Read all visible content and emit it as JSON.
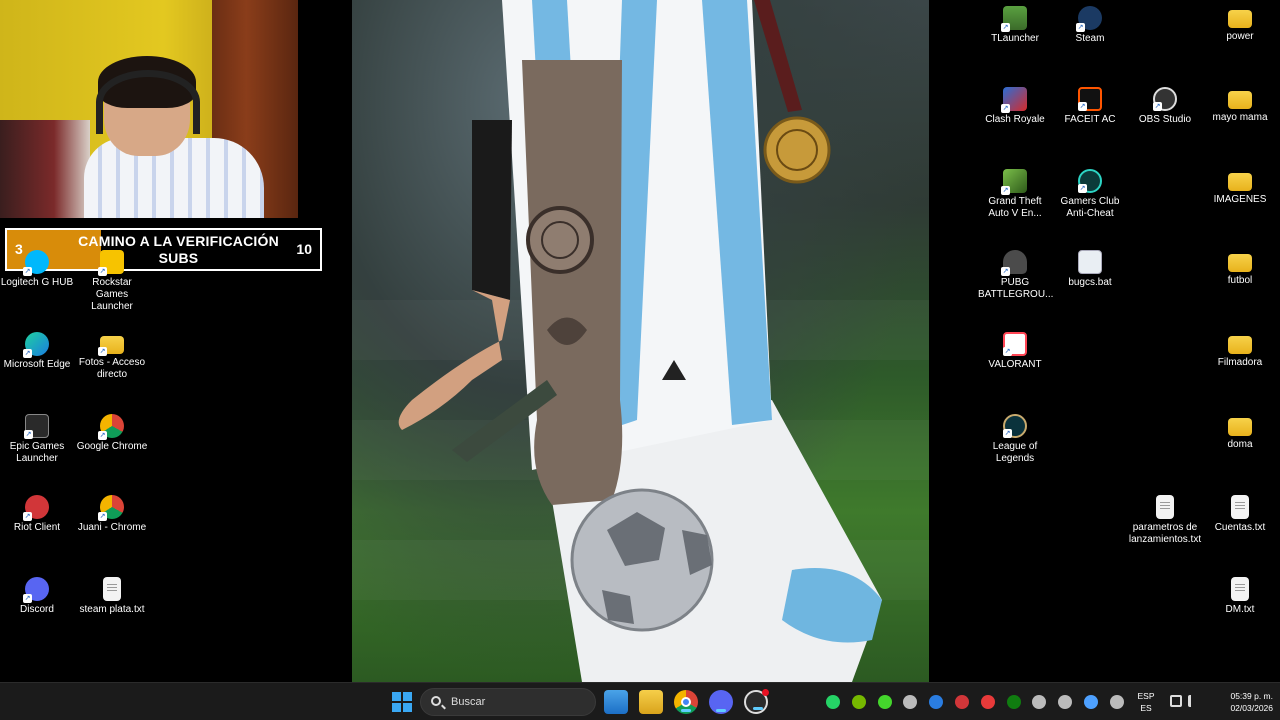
{
  "goal": {
    "title": "CAMINO A LA VERIFICACIÓN SUBS",
    "current": "3",
    "target": "10",
    "progress": 0.3,
    "fill_color": "#d88c0a"
  },
  "desktop_icons": {
    "left": [
      {
        "label": "Logitech G HUB",
        "icon": "logitech-icon",
        "shortcut": true
      },
      {
        "label": "Rockstar Games Launcher",
        "icon": "rockstar-icon",
        "shortcut": true
      },
      {
        "label": "Microsoft Edge",
        "icon": "edge-icon",
        "shortcut": true
      },
      {
        "label": "Fotos - Acceso directo",
        "icon": "folder-icon",
        "shortcut": true
      },
      {
        "label": "Epic Games Launcher",
        "icon": "epic-games-icon",
        "shortcut": true
      },
      {
        "label": "Google Chrome",
        "icon": "chrome-icon",
        "shortcut": true
      },
      {
        "label": "Riot Client",
        "icon": "riot-icon",
        "shortcut": true
      },
      {
        "label": "Juani - Chrome",
        "icon": "chrome-profile-icon",
        "shortcut": true
      },
      {
        "label": "Discord",
        "icon": "discord-icon",
        "shortcut": true
      },
      {
        "label": "steam plata.txt",
        "icon": "text-file-icon",
        "shortcut": false
      }
    ],
    "right": [
      {
        "label": "TLauncher",
        "icon": "tlauncher-icon",
        "shortcut": true
      },
      {
        "label": "Steam",
        "icon": "steam-icon",
        "shortcut": true
      },
      {
        "label": "power",
        "icon": "folder-icon",
        "shortcut": false
      },
      {
        "label": "Clash Royale",
        "icon": "clash-royale-icon",
        "shortcut": true
      },
      {
        "label": "FACEIT AC",
        "icon": "faceit-icon",
        "shortcut": true
      },
      {
        "label": "OBS Studio",
        "icon": "obs-icon",
        "shortcut": true
      },
      {
        "label": "mayo mama",
        "icon": "folder-icon",
        "shortcut": false
      },
      {
        "label": "Grand Theft Auto V En...",
        "icon": "gta-icon",
        "shortcut": true
      },
      {
        "label": "Gamers Club Anti-Cheat",
        "icon": "gamers-club-icon",
        "shortcut": true
      },
      {
        "label": "IMAGENES",
        "icon": "folder-icon",
        "shortcut": false
      },
      {
        "label": "PUBG BATTLEGROU...",
        "icon": "pubg-icon",
        "shortcut": true
      },
      {
        "label": "bugcs.bat",
        "icon": "bat-file-icon",
        "shortcut": false
      },
      {
        "label": "futbol",
        "icon": "folder-icon",
        "shortcut": false
      },
      {
        "label": "VALORANT",
        "icon": "valorant-icon",
        "shortcut": true
      },
      {
        "label": "Filmadora",
        "icon": "folder-icon",
        "shortcut": false
      },
      {
        "label": "League of Legends",
        "icon": "league-icon",
        "shortcut": true
      },
      {
        "label": "doma",
        "icon": "folder-icon",
        "shortcut": false
      },
      {
        "label": "parametros de lanzamientos.txt",
        "icon": "text-file-icon",
        "shortcut": false
      },
      {
        "label": "Cuentas.txt",
        "icon": "text-file-icon",
        "shortcut": false
      },
      {
        "label": "DM.txt",
        "icon": "text-file-icon",
        "shortcut": false
      }
    ]
  },
  "taskbar": {
    "search_placeholder": "Buscar",
    "pinned": [
      "windows-start-icon",
      "microsoft-store-icon",
      "file-explorer-icon",
      "chrome-icon",
      "discord-icon",
      "obs-icon"
    ],
    "tray_icons": [
      "whatsapp-icon",
      "nvidia-icon",
      "razer-icon",
      "logitech-icon",
      "bluetooth-icon",
      "riot-tray-icon",
      "app-red-icon",
      "xbox-icon",
      "steam-tray-icon",
      "usb-icon",
      "microphone-icon",
      "keyboard-icon"
    ],
    "language_line1": "ESP",
    "language_line2": "ES",
    "time": "05:39 p. m.",
    "date": "02/03/2026"
  },
  "colors": {
    "accent": "#60cdff",
    "taskbar": "#1b1b1b",
    "desktop": "#000000"
  }
}
